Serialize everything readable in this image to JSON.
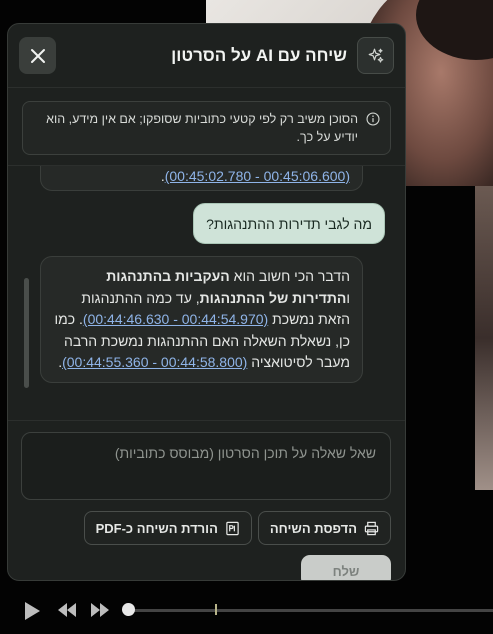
{
  "header": {
    "title": "שיחה עם AI על הסרטון",
    "sparkle_icon": "sparkle-icon",
    "close_icon": "close-icon"
  },
  "notice": {
    "icon": "info-icon",
    "text": "הסוכן משיב רק לפי קטעי כתוביות שסופקו; אם אין מידע, הוא יודיע על כך."
  },
  "chat": {
    "prev_ai_tail_ts": "(00:45:02.780 - 00:45:06.600)",
    "prev_ai_tail_end": ".",
    "user_message": "מה לגבי תדירות ההתנהגות?",
    "ai_message": {
      "p1": "הדבר הכי חשוב הוא ",
      "b1": "העקביות בהתנהגות",
      "p2": " ו",
      "b2": "התדירות של ההתנהגות",
      "p3": ", עד כמה ההתנהגות הזאת נמשכת ",
      "ts1": "(00:44:46.630 - 00:44:54.970)",
      "p4": ". כמו כן, נשאלת השאלה האם ההתנהגות נמשכת הרבה מעבר לסיטואציה ",
      "ts2": "(00:44:55.360 - 00:44:58.800)",
      "p5": "."
    }
  },
  "composer": {
    "placeholder": "שאל שאלה על תוכן הסרטון (מבוסס כתוביות)",
    "print_label": "הדפסת השיחה",
    "print_icon": "printer-icon",
    "pdf_label": "הורדת השיחה כ-PDF",
    "pdf_icon": "pdf-icon",
    "send_label": "שלח"
  },
  "player": {
    "play_icon": "play-icon",
    "rewind_icon": "rewind-icon",
    "forward_icon": "fast-forward-icon"
  },
  "colors": {
    "panel_bg": "#1e211f",
    "user_bubble": "#cfe3d8",
    "timestamp_link": "#8fb4e8"
  }
}
